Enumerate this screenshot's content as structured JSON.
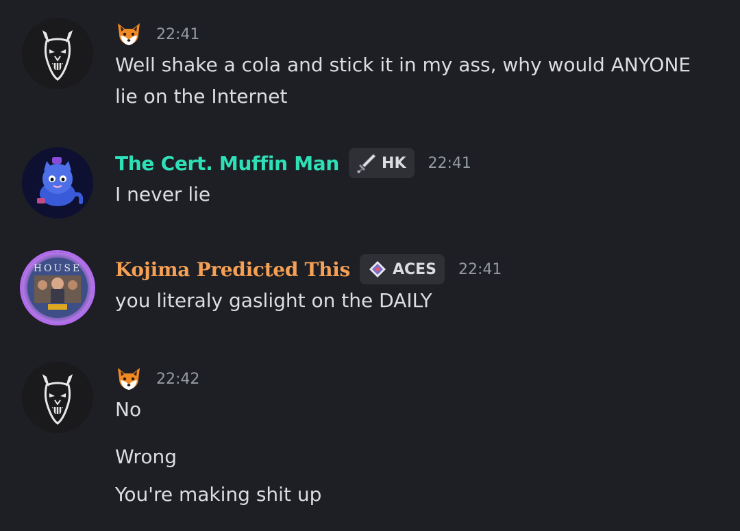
{
  "colors": {
    "background": "#1e1f24",
    "text": "#dcdde0",
    "timestamp": "#949ba4",
    "muffin_man_name": "#2ee0b7",
    "kojima_name": "#f5a055",
    "tag_bg": "#2e3036"
  },
  "messages": [
    {
      "avatar_icon": "oni-mask-icon",
      "author_icon": "fox-emoji-icon",
      "timestamp": "22:41",
      "lines": [
        "Well shake a cola and stick it in my ass, why would ANYONE",
        "lie on the Internet"
      ]
    },
    {
      "avatar_icon": "blue-cat-avatar",
      "author": "The Cert. Muffin Man",
      "tag": {
        "icon": "sword-icon",
        "label": "HK"
      },
      "timestamp": "22:41",
      "lines": [
        "I never lie"
      ]
    },
    {
      "avatar_icon": "house-poster-avatar",
      "author": "Kojima Predicted This",
      "tag": {
        "icon": "diamond-gem-icon",
        "label": "ACES"
      },
      "timestamp": "22:41",
      "lines": [
        "you literaly gaslight on the DAILY"
      ]
    },
    {
      "avatar_icon": "oni-mask-icon",
      "author_icon": "fox-emoji-icon",
      "timestamp": "22:42",
      "lines": [
        "No",
        "Wrong",
        "You're making shit up"
      ]
    }
  ]
}
